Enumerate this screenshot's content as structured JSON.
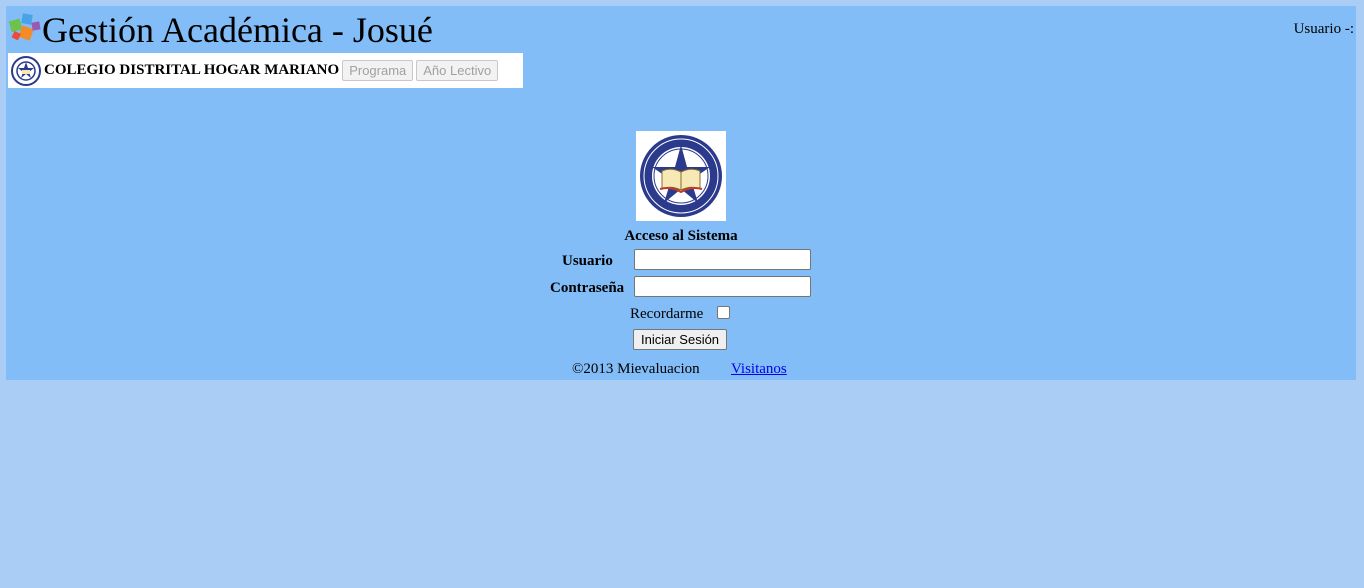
{
  "header": {
    "app_title": "Gestión Académica - Josué",
    "user_label": "Usuario -:",
    "logo_icon": "colored-cubes-icon"
  },
  "school_bar": {
    "school_name": "COLEGIO DISTRITAL HOGAR MARIANO",
    "seal_icon": "school-seal-icon",
    "menu": [
      {
        "label": "Programa",
        "enabled": false
      },
      {
        "label": "Año Lectivo",
        "enabled": false
      }
    ]
  },
  "login": {
    "logo_icon": "school-emblem-icon",
    "title": "Acceso al Sistema",
    "username_label": "Usuario",
    "username_value": "",
    "password_label": "Contraseña",
    "password_value": "",
    "remember_label": "Recordarme",
    "remember_checked": false,
    "submit_label": "Iniciar Sesión"
  },
  "footer": {
    "copyright": "©2013 Mievaluacion",
    "link_label": "Visitanos"
  },
  "colors": {
    "page_background": "#a9cdf4",
    "panel_background": "#82bdf7",
    "link": "#0000ee"
  }
}
